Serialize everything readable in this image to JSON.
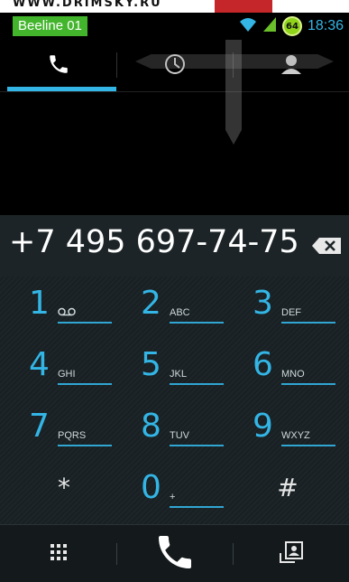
{
  "watermark": {
    "text": "WWW.DRIMSKY.RU"
  },
  "status_bar": {
    "carrier": "Beeline 01",
    "battery_level": "64",
    "time": "18:36",
    "icons": [
      "wifi-icon",
      "signal-icon",
      "battery-icon"
    ]
  },
  "tabs": [
    {
      "name": "phone",
      "icon": "phone-icon",
      "active": true
    },
    {
      "name": "recent",
      "icon": "clock-icon",
      "active": false
    },
    {
      "name": "contacts",
      "icon": "person-icon",
      "active": false
    }
  ],
  "dialer": {
    "number": "+7 495 697-74-75",
    "backspace_icon": "backspace-icon"
  },
  "keypad": {
    "keys": [
      {
        "digit": "1",
        "letters": "voicemail",
        "icon": "voicemail-icon"
      },
      {
        "digit": "2",
        "letters": "ABC"
      },
      {
        "digit": "3",
        "letters": "DEF"
      },
      {
        "digit": "4",
        "letters": "GHI"
      },
      {
        "digit": "5",
        "letters": "JKL"
      },
      {
        "digit": "6",
        "letters": "MNO"
      },
      {
        "digit": "7",
        "letters": "PQRS"
      },
      {
        "digit": "8",
        "letters": "TUV"
      },
      {
        "digit": "9",
        "letters": "WXYZ"
      },
      {
        "digit": "*",
        "letters": ""
      },
      {
        "digit": "0",
        "letters": "+"
      },
      {
        "digit": "#",
        "letters": ""
      }
    ]
  },
  "actions": [
    {
      "name": "dialpad",
      "icon": "dialpad-icon"
    },
    {
      "name": "call",
      "icon": "phone-call-icon"
    },
    {
      "name": "add-contact",
      "icon": "add-contact-icon"
    }
  ],
  "colors": {
    "accent": "#33b5e5",
    "carrier_badge": "#43b52c",
    "battery": "#8fd41a"
  }
}
